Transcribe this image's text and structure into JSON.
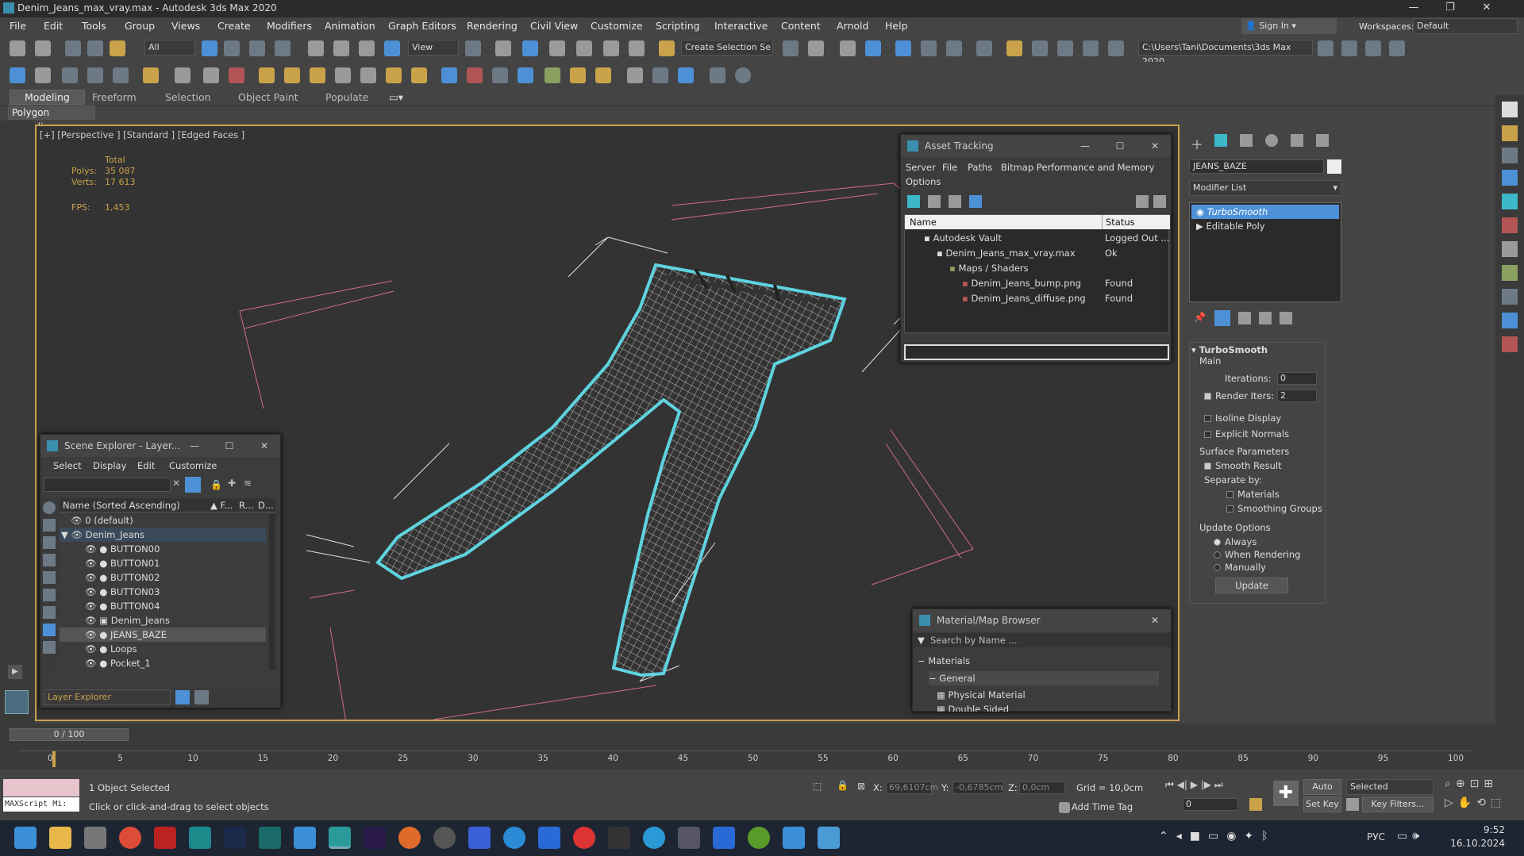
{
  "app": {
    "title": "Denim_Jeans_max_vray.max - Autodesk 3ds Max 2020"
  },
  "menu": [
    "File",
    "Edit",
    "Tools",
    "Group",
    "Views",
    "Create",
    "Modifiers",
    "Animation",
    "Graph Editors",
    "Rendering",
    "Civil View",
    "Customize",
    "Scripting",
    "Interactive",
    "Content",
    "Arnold",
    "Help"
  ],
  "account": {
    "sign_in": "Sign In",
    "workspaces_label": "Workspaces:",
    "workspace": "Default"
  },
  "toolbar": {
    "filter": "All",
    "view": "View",
    "selection_set": "Create Selection Se",
    "path": "C:\\Users\\Tani\\Documents\\3ds Max 2020"
  },
  "ribbon": {
    "tabs": [
      "Modeling",
      "Freeform",
      "Selection",
      "Object Paint",
      "Populate"
    ],
    "sub": "Polygon Modeling"
  },
  "viewport": {
    "label": "[+] [Perspective ] [Standard ] [Edged Faces ]",
    "total_label": "Total",
    "polys_label": "Polys:",
    "polys": "35 087",
    "verts_label": "Verts:",
    "verts": "17 613",
    "fps_label": "FPS:",
    "fps": "1,453"
  },
  "asset_tracking": {
    "title": "Asset Tracking",
    "menu": [
      "Server",
      "File",
      "Paths",
      "Bitmap Performance and Memory",
      "Options"
    ],
    "col_name": "Name",
    "col_status": "Status",
    "rows": [
      {
        "name": "Autodesk Vault",
        "status": "Logged Out ..."
      },
      {
        "name": "Denim_Jeans_max_vray.max",
        "status": "Ok"
      },
      {
        "name": "Maps / Shaders",
        "status": ""
      },
      {
        "name": "Denim_Jeans_bump.png",
        "status": "Found"
      },
      {
        "name": "Denim_Jeans_diffuse.png",
        "status": "Found"
      }
    ]
  },
  "scene_explorer": {
    "title": "Scene Explorer - Layer...",
    "menu": [
      "Select",
      "Display",
      "Edit",
      "Customize"
    ],
    "col_name": "Name (Sorted Ascending)",
    "col_f": "▲ F...",
    "col_r": "R...",
    "col_d": "D...",
    "rows": [
      "0 (default)",
      "Denim_Jeans",
      "BUTTON00",
      "BUTTON01",
      "BUTTON02",
      "BUTTON03",
      "BUTTON04",
      "Denim_Jeans",
      "JEANS_BAZE",
      "Loops",
      "Pocket_1"
    ],
    "footer": "Layer Explorer"
  },
  "material_browser": {
    "title": "Material/Map Browser",
    "search": "Search by Name ...",
    "materials": "Materials",
    "general": "General",
    "item1": "Physical Material",
    "item2": "Double Sided"
  },
  "command_panel": {
    "object_name": "JEANS_BAZE",
    "modifier_list": "Modifier List",
    "stack": [
      "TurboSmooth",
      "Editable Poly"
    ],
    "rollout": "TurboSmooth",
    "main": "Main",
    "iterations_label": "Iterations:",
    "iterations": "0",
    "render_iters_label": "Render Iters:",
    "render_iters": "2",
    "isoline": "Isoline Display",
    "explicit": "Explicit Normals",
    "surface": "Surface Parameters",
    "smooth_result": "Smooth Result",
    "separate": "Separate by:",
    "materials": "Materials",
    "smoothing": "Smoothing Groups",
    "update_options": "Update Options",
    "always": "Always",
    "when_rendering": "When Rendering",
    "manually": "Manually",
    "update": "Update"
  },
  "timeline": {
    "frame": "0 / 100",
    "ticks": [
      "0",
      "5",
      "10",
      "15",
      "20",
      "25",
      "30",
      "35",
      "40",
      "45",
      "50",
      "55",
      "60",
      "65",
      "70",
      "75",
      "80",
      "85",
      "90",
      "95",
      "100"
    ]
  },
  "status": {
    "script": "MAXScript Mi:",
    "selected": "1 Object Selected",
    "hint": "Click or click-and-drag to select objects",
    "x_label": "X:",
    "x": "69,6107cm",
    "y_label": "Y:",
    "y": "-0,6785cm",
    "z_label": "Z:",
    "z": "0,0cm",
    "grid": "Grid = 10,0cm",
    "add_time_tag": "Add Time Tag",
    "auto_key": "Auto Key",
    "set_key": "Set Key",
    "selected_mode": "Selected",
    "key_filters": "Key Filters...",
    "frame": "0"
  },
  "taskbar": {
    "lang": "РУС",
    "time": "9:52",
    "date": "16.10.2024"
  },
  "colors": {
    "accent": "#4e90d6",
    "viewport_border": "#c9a24a",
    "wire_select": "#5fd3e0",
    "grid_pink": "#d46a8c"
  }
}
